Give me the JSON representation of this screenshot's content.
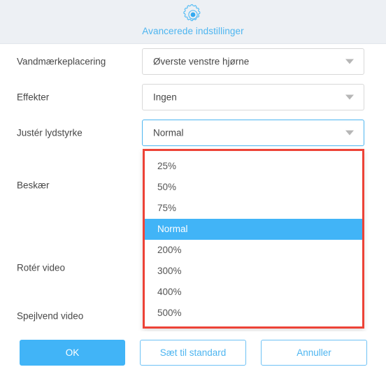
{
  "header": {
    "icon": "gear-icon",
    "title": "Avancerede indstillinger",
    "accent_color": "#4db5f0",
    "background_color": "#edf0f4"
  },
  "form": {
    "rows": [
      {
        "label": "Vandmærkeplacering",
        "value": "Øverste venstre hjørne",
        "focused": false
      },
      {
        "label": "Effekter",
        "value": "Ingen",
        "focused": false
      },
      {
        "label": "Justér lydstyrke",
        "value": "Normal",
        "focused": true
      },
      {
        "label": "Beskær",
        "value": "",
        "focused": false
      },
      {
        "label": "Rotér video",
        "value": "",
        "focused": false
      },
      {
        "label": "Spejlvend video",
        "value": "",
        "focused": false
      }
    ]
  },
  "dropdown": {
    "open": true,
    "selected": "Normal",
    "annotation_color": "#ed4337",
    "highlight_color": "#41b4f7",
    "options": [
      "25%",
      "50%",
      "75%",
      "Normal",
      "200%",
      "300%",
      "400%",
      "500%"
    ]
  },
  "footer": {
    "ok_label": "OK",
    "default_label": "Sæt til standard",
    "cancel_label": "Annuller"
  }
}
